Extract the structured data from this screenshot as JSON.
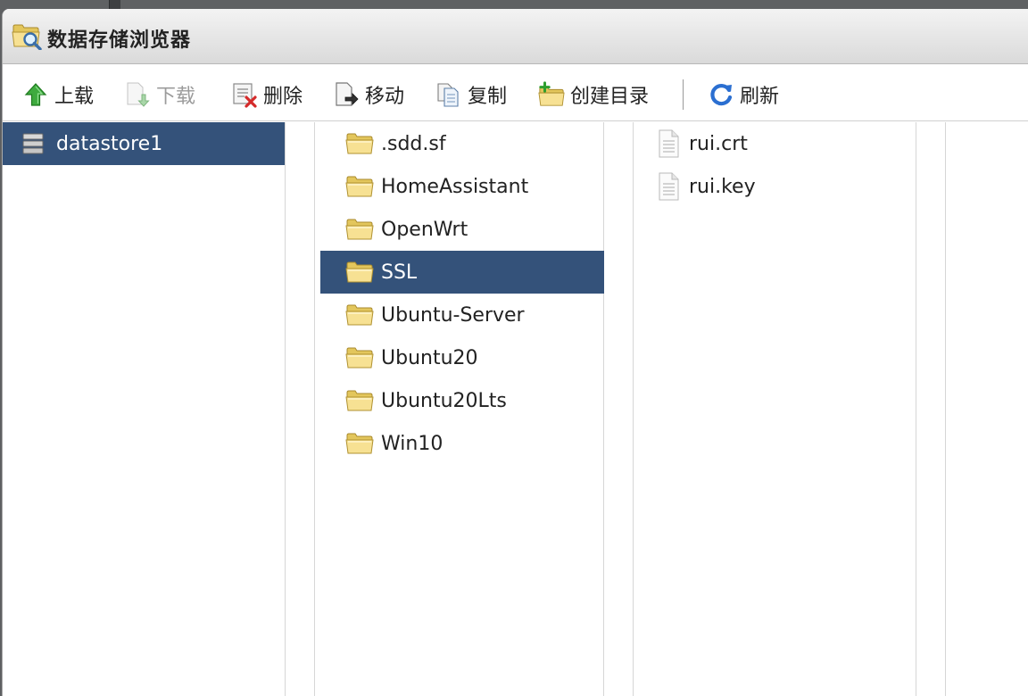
{
  "window": {
    "title": "数据存储浏览器"
  },
  "toolbar": {
    "upload": "上载",
    "download": "下载",
    "delete": "删除",
    "move": "移动",
    "copy": "复制",
    "create_dir": "创建目录",
    "refresh": "刷新"
  },
  "datastores": [
    {
      "label": "datastore1",
      "selected": true
    }
  ],
  "folders": [
    {
      "label": ".sdd.sf"
    },
    {
      "label": "HomeAssistant"
    },
    {
      "label": "OpenWrt"
    },
    {
      "label": "SSL",
      "selected": true
    },
    {
      "label": "Ubuntu-Server"
    },
    {
      "label": "Ubuntu20"
    },
    {
      "label": "Ubuntu20Lts"
    },
    {
      "label": "Win10"
    }
  ],
  "files": [
    {
      "label": "rui.crt"
    },
    {
      "label": "rui.key"
    }
  ],
  "colors": {
    "selection": "#34527a",
    "disabled_text": "#9b9b9b"
  }
}
